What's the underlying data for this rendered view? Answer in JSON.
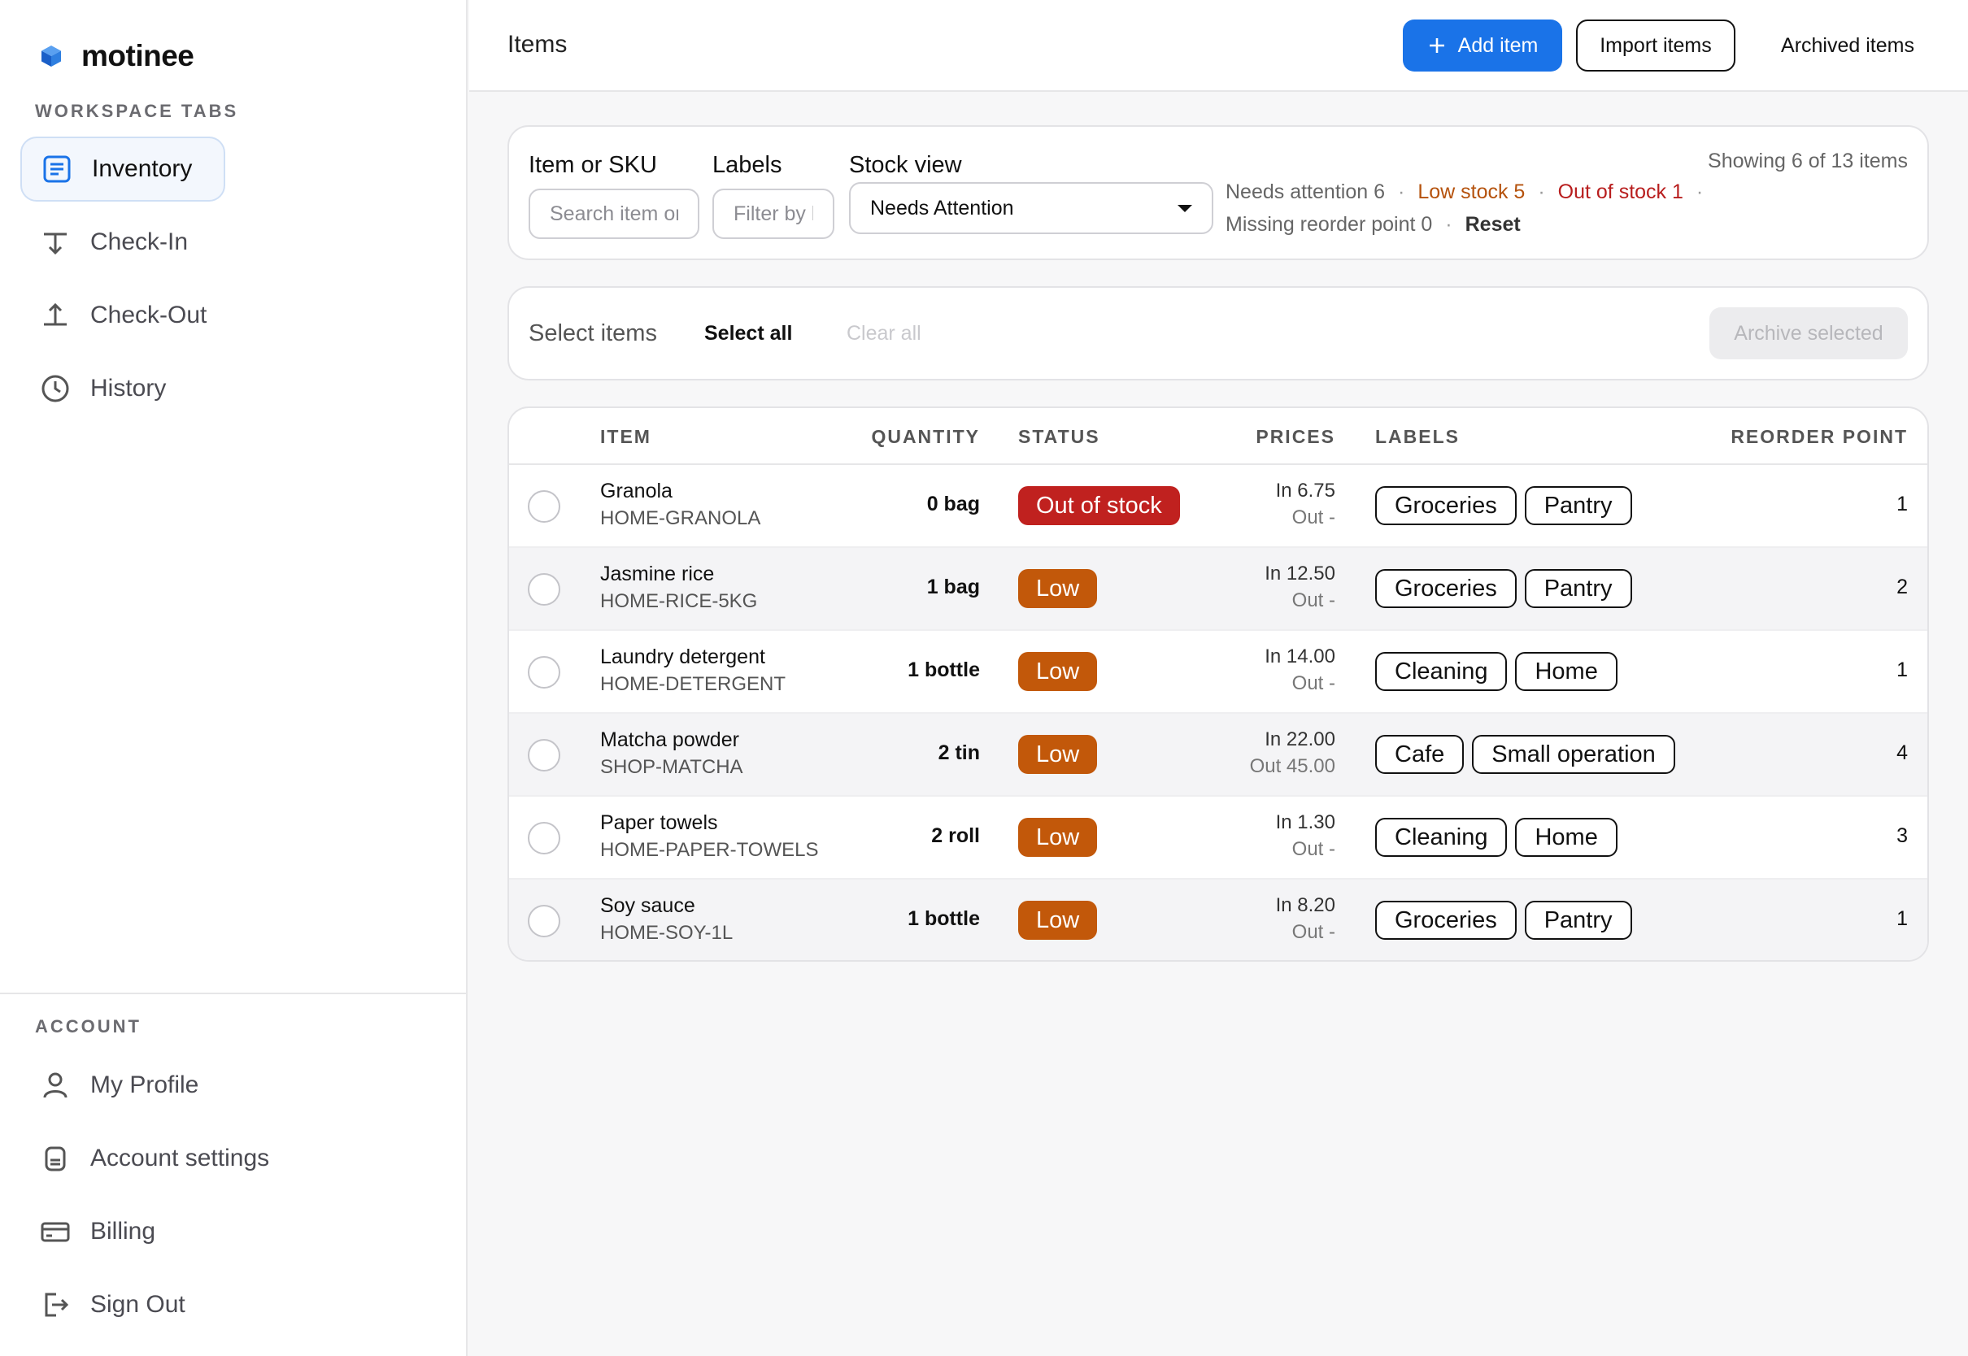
{
  "brand": {
    "name": "motinee",
    "accent": "#1a73e8"
  },
  "sidebar": {
    "workspace_label": "WORKSPACE TABS",
    "items": [
      {
        "label": "Inventory",
        "icon": "list-icon",
        "active": true
      },
      {
        "label": "Check-In",
        "icon": "arrow-down-icon",
        "active": false
      },
      {
        "label": "Check-Out",
        "icon": "arrow-up-icon",
        "active": false
      },
      {
        "label": "History",
        "icon": "clock-icon",
        "active": false
      }
    ],
    "account_label": "ACCOUNT",
    "account_items": [
      {
        "label": "My Profile",
        "icon": "user-icon"
      },
      {
        "label": "Account settings",
        "icon": "settings-icon"
      },
      {
        "label": "Billing",
        "icon": "card-icon"
      },
      {
        "label": "Sign Out",
        "icon": "sign-out-icon"
      }
    ]
  },
  "header": {
    "title": "Items",
    "add_label": "Add item",
    "import_label": "Import items",
    "archived_label": "Archived items"
  },
  "filters": {
    "item_label": "Item or SKU",
    "item_placeholder": "Search item or",
    "labels_label": "Labels",
    "labels_placeholder": "Filter by l",
    "stock_label": "Stock view",
    "stock_value": "Needs Attention",
    "needs_attention": "Needs attention 6",
    "low_stock": "Low stock 5",
    "out_of_stock": "Out of stock 1",
    "missing_reorder": "Missing reorder point 0",
    "reset": "Reset",
    "showing": "Showing 6 of 13 items"
  },
  "selection": {
    "title": "Select items",
    "select_all": "Select all",
    "clear_all": "Clear all",
    "archive": "Archive selected"
  },
  "table": {
    "columns": {
      "item": "ITEM",
      "quantity": "QUANTITY",
      "status": "STATUS",
      "prices": "PRICES",
      "labels": "LABELS",
      "reorder": "REORDER POINT"
    },
    "rows": [
      {
        "name": "Granola",
        "sku": "HOME-GRANOLA",
        "qty": "0 bag",
        "status": "Out of stock",
        "price_in": "In 6.75",
        "price_out": "Out -",
        "labels": [
          "Groceries",
          "Pantry"
        ],
        "reorder": "1"
      },
      {
        "name": "Jasmine rice",
        "sku": "HOME-RICE-5KG",
        "qty": "1 bag",
        "status": "Low",
        "price_in": "In 12.50",
        "price_out": "Out -",
        "labels": [
          "Groceries",
          "Pantry"
        ],
        "reorder": "2"
      },
      {
        "name": "Laundry detergent",
        "sku": "HOME-DETERGENT",
        "qty": "1 bottle",
        "status": "Low",
        "price_in": "In 14.00",
        "price_out": "Out -",
        "labels": [
          "Cleaning",
          "Home"
        ],
        "reorder": "1"
      },
      {
        "name": "Matcha powder",
        "sku": "SHOP-MATCHA",
        "qty": "2 tin",
        "status": "Low",
        "price_in": "In 22.00",
        "price_out": "Out 45.00",
        "labels": [
          "Cafe",
          "Small operation"
        ],
        "reorder": "4"
      },
      {
        "name": "Paper towels",
        "sku": "HOME-PAPER-TOWELS",
        "qty": "2 roll",
        "status": "Low",
        "price_in": "In 1.30",
        "price_out": "Out -",
        "labels": [
          "Cleaning",
          "Home"
        ],
        "reorder": "3"
      },
      {
        "name": "Soy sauce",
        "sku": "HOME-SOY-1L",
        "qty": "1 bottle",
        "status": "Low",
        "price_in": "In 8.20",
        "price_out": "Out -",
        "labels": [
          "Groceries",
          "Pantry"
        ],
        "reorder": "1"
      }
    ]
  }
}
